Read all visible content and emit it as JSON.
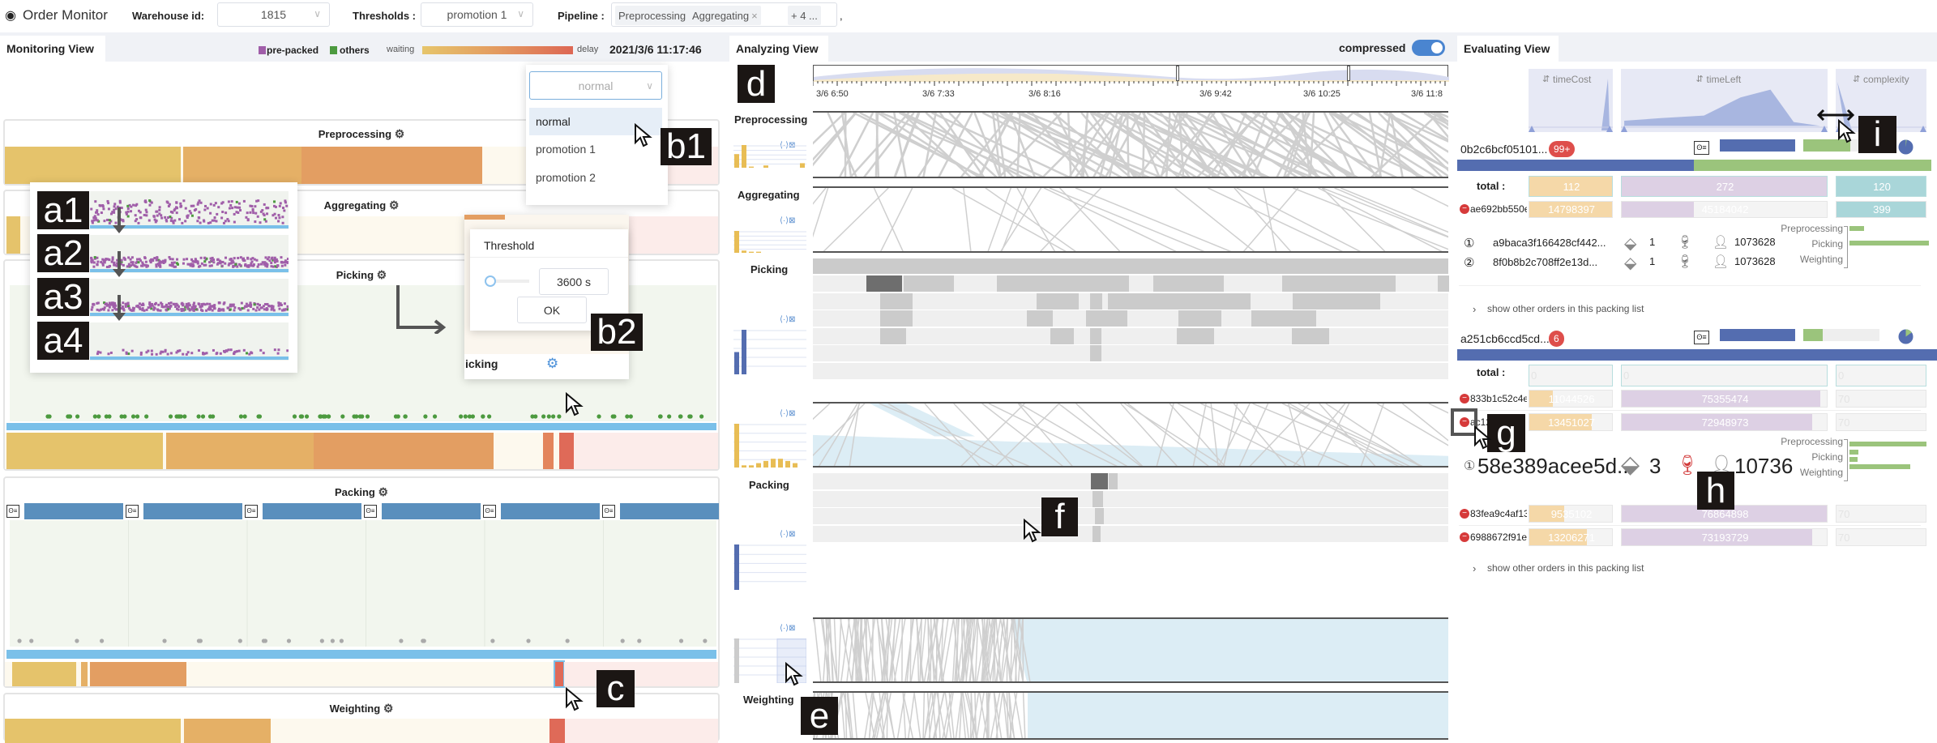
{
  "header": {
    "title": "Order Monitor",
    "warehouse_label": "Warehouse id:",
    "warehouse_value": "1815",
    "thresholds_label": "Thresholds :",
    "thresholds_value": "promotion 1",
    "pipeline_label": "Pipeline :",
    "pipeline_tags": [
      "Preprocessing",
      "Aggregating"
    ],
    "pipeline_more": "+ 4 ...",
    "trailing": ","
  },
  "colors": {
    "pre_packed": "#a05ea9",
    "others": "#4c9a3f",
    "waiting": "#e6c56b",
    "delay": "#dd6754",
    "accent": "#4a90d9",
    "blue_bar": "#5a8fbd",
    "time_cost": "#f5d8a8",
    "time_left": "#ddd0e4",
    "complexity": "#a9d6d9",
    "list_blue": "#546db0",
    "list_green": "#9bc47c"
  },
  "monitoring": {
    "tab": "Monitoring View",
    "legend": {
      "pre_packed": "pre-packed",
      "others": "others",
      "waiting": "waiting",
      "delay": "delay"
    },
    "timestamp": "2021/3/6 11:17:46",
    "stages": [
      "Preprocessing",
      "Aggregating",
      "Picking",
      "Packing",
      "Weighting"
    ],
    "dropdown": {
      "value": "normal",
      "options": [
        "normal",
        "promotion 1",
        "promotion 2"
      ],
      "highlighted": "normal"
    },
    "threshold": {
      "title": "Threshold",
      "value": "3600 s",
      "ok": "OK",
      "stage_fragment": "icking"
    },
    "annotations": {
      "a1": "a1",
      "a2": "a2",
      "a3": "a3",
      "a4": "a4",
      "b1": "b1",
      "b2": "b2",
      "c": "c"
    }
  },
  "analyzing": {
    "tab": "Analyzing View",
    "compressed_label": "compressed",
    "compressed": true,
    "ticks": [
      "3/6 6:50",
      "3/6 7:33",
      "3/6 8:16",
      "3/6 9:42",
      "3/6 10:25",
      "3/6 11:8"
    ],
    "stages": [
      "Preprocessing",
      "Aggregating",
      "Picking",
      "Packing",
      "Weighting"
    ],
    "annotations": {
      "d": "d",
      "e": "e",
      "f": "f"
    }
  },
  "evaluating": {
    "tab": "Evaluating View",
    "columns": [
      "timeCost",
      "timeLeft",
      "complexity"
    ],
    "total_label": "total :",
    "show_more": "show other orders in this packing list",
    "annotations": {
      "g": "g",
      "h": "h",
      "i": "i"
    },
    "lists": [
      {
        "id": "0b2c6bcf05101...",
        "badge": "99+",
        "green_fill": 0.62,
        "pie_green": 0.02,
        "split_blue": 0.5,
        "totals": [
          "112",
          "272",
          "120"
        ],
        "orders": [
          {
            "id": "ae692bb550e",
            "values": [
              "14798397",
              "45184042",
              "399"
            ],
            "fills": [
              1,
              0.35,
              1
            ]
          }
        ],
        "items": [
          {
            "num": "①",
            "id": "a9baca3f166428cf442...",
            "boxes": "1",
            "weight": "1073628"
          },
          {
            "num": "②",
            "id": "8f0b8b2c708ff2e13d...",
            "boxes": "1",
            "weight": "1073628"
          }
        ],
        "stage_labels": [
          "Preprocessing",
          "Picking",
          "Weighting"
        ]
      },
      {
        "id": "a251cb6ccd5cd...",
        "badge": "6",
        "green_fill": 0.26,
        "pie_green": 0.15,
        "split_blue": 1,
        "totals": [
          "0",
          "0",
          "0"
        ],
        "orders": [
          {
            "id": "833b1c52c4e",
            "values": [
              "11044526",
              "75355474",
              "70"
            ],
            "fills": [
              0.28,
              0.97,
              0
            ]
          },
          {
            "id": "ac12",
            "values": [
              "13451027",
              "72948973",
              "70"
            ],
            "fills": [
              0.75,
              0.93,
              0
            ]
          },
          {
            "id": "83fea9c4af13",
            "values": [
              "9535102",
              "76864898",
              "70"
            ],
            "fills": [
              0.42,
              1,
              0
            ]
          },
          {
            "id": "6988672f91ee",
            "values": [
              "13206271",
              "73193729",
              "70"
            ],
            "fills": [
              0.7,
              0.93,
              0
            ]
          }
        ],
        "expanded": {
          "num": "①",
          "id": "58e389acee5d...",
          "boxes": "3",
          "weight": "10736"
        },
        "stage_labels": [
          "Preprocessing",
          "Picking",
          "Weighting"
        ]
      }
    ]
  }
}
